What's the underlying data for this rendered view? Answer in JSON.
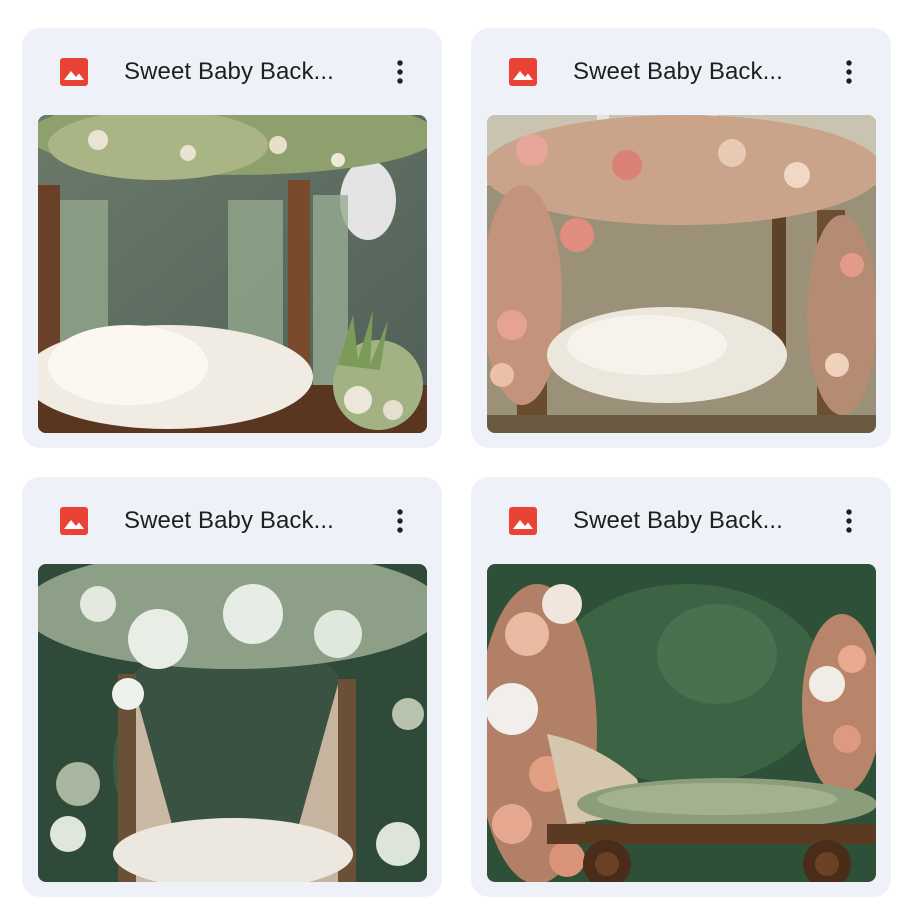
{
  "files": [
    {
      "title": "Sweet Baby Back...",
      "file_type_icon": "image-file-icon",
      "menu_icon": "more-vert-icon",
      "thumbnail": "wooden bed with green drapes, white fur blanket and white-green flower garland"
    },
    {
      "title": "Sweet Baby Back...",
      "file_type_icon": "image-file-icon",
      "menu_icon": "more-vert-icon",
      "thumbnail": "rustic bed frame covered in pink and peach roses with white fur blanket"
    },
    {
      "title": "Sweet Baby Back...",
      "file_type_icon": "image-file-icon",
      "menu_icon": "more-vert-icon",
      "thumbnail": "arched canopy of white hydrangeas with beige drapes and fur blanket"
    },
    {
      "title": "Sweet Baby Back...",
      "file_type_icon": "image-file-icon",
      "menu_icon": "more-vert-icon",
      "thumbnail": "wooden cart bed with peach and white flowers on dark green background"
    }
  ],
  "colors": {
    "card_background": "#eef2f8",
    "icon_red": "#ea4335",
    "title_text": "#1f1f1f"
  }
}
